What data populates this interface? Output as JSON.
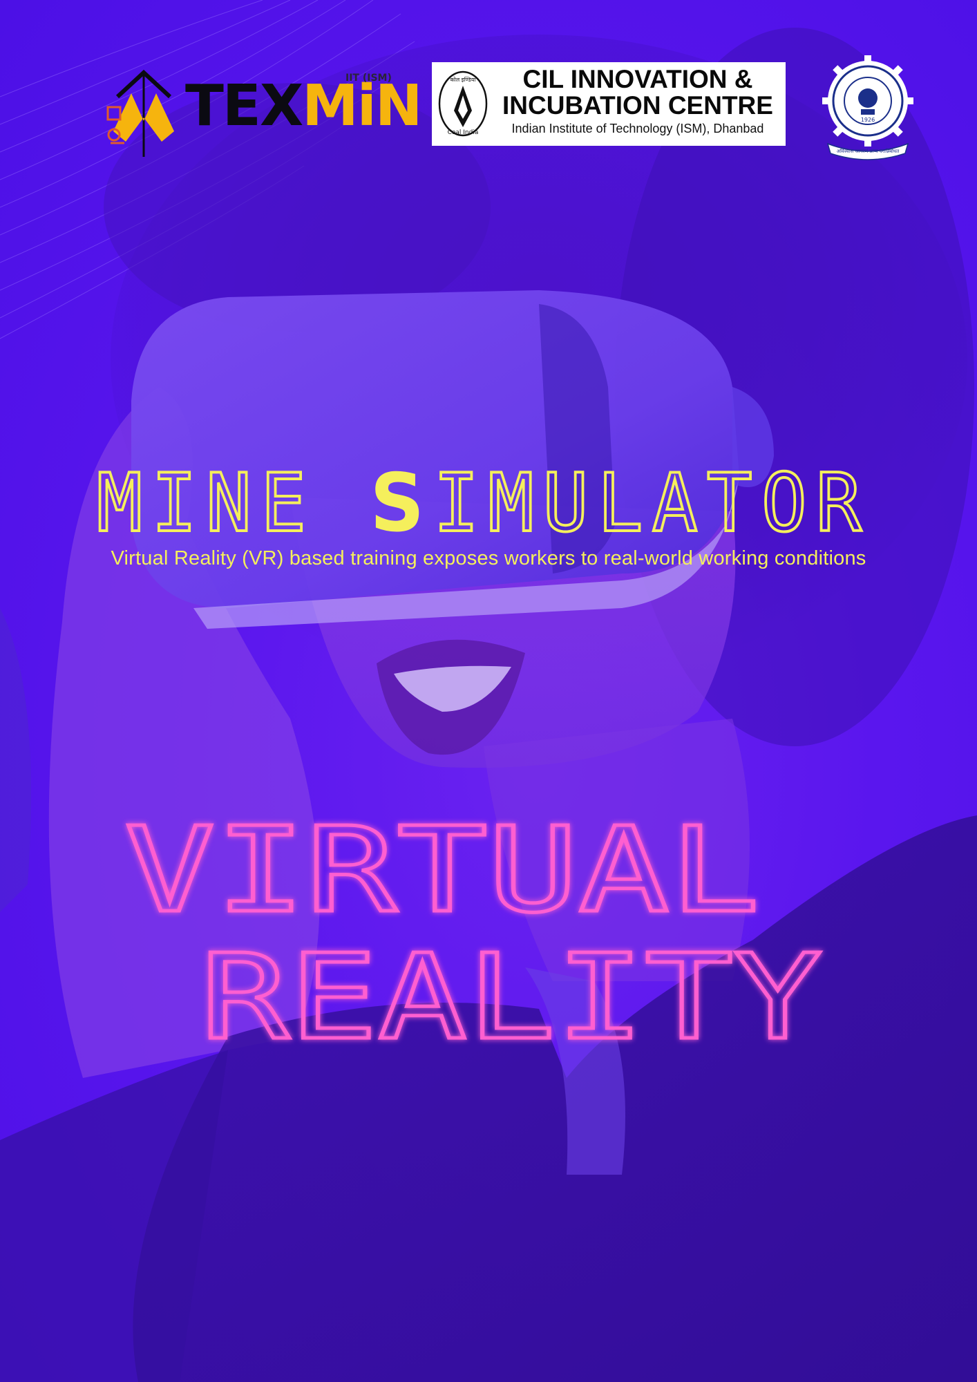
{
  "logos": {
    "texmin": {
      "prefix": "TEX",
      "suffix": "MiN",
      "badge": "IIT (ISM)"
    },
    "cil": {
      "line1": "CIL INNOVATION &",
      "line2": "INCUBATION CENTRE",
      "line3": "Indian Institute of Technology (ISM), Dhanbad",
      "emblem_text": "Coal India",
      "emblem_script": "कोल इण्डिया"
    },
    "ism_seal": {
      "motto": "अविश्वास जागरणं प्राप्य वरान्निबोधत",
      "year": "1926"
    }
  },
  "headline": {
    "part1": "MINE ",
    "accent_letter": "S",
    "part2": "IMULATOR",
    "subtitle": "Virtual Reality (VR) based training exposes workers to real-world working conditions"
  },
  "feature": {
    "line1": "VIRTUAL",
    "line2": "REALITY"
  },
  "colors": {
    "background": "#5a16ee",
    "headline": "#f5ef5c",
    "feature": "#ff5fd0",
    "texmin_orange": "#f6b40e"
  }
}
